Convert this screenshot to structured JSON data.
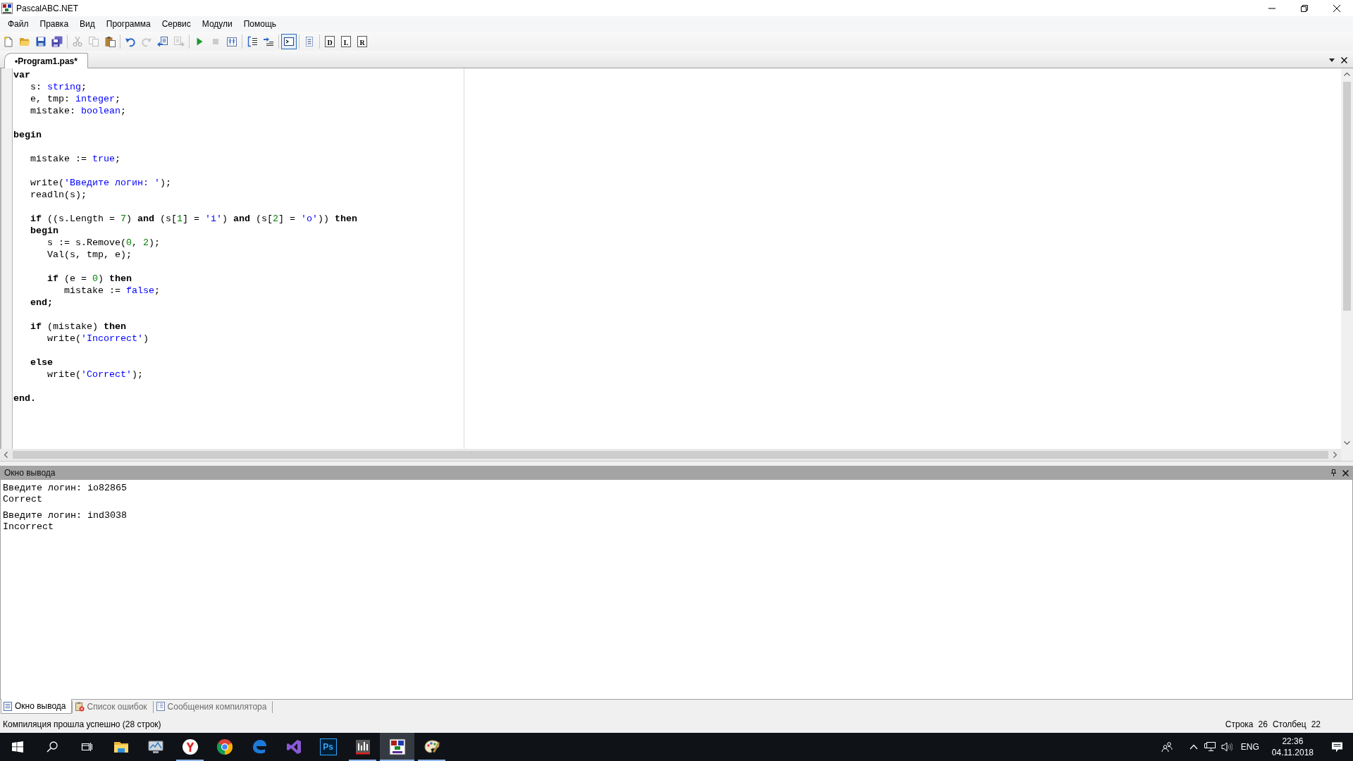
{
  "window": {
    "title": "PascalABC.NET"
  },
  "menu": [
    "Файл",
    "Правка",
    "Вид",
    "Программа",
    "Сервис",
    "Модули",
    "Помощь"
  ],
  "toolbar": [
    {
      "items": [
        {
          "kind": "icon",
          "disabled": false,
          "pressed": false
        },
        {
          "kind": "icon",
          "disabled": false,
          "pressed": false
        },
        {
          "kind": "icon",
          "disabled": false,
          "pressed": false
        },
        {
          "kind": "icon",
          "disabled": false,
          "pressed": false
        }
      ]
    },
    {
      "items": [
        {
          "kind": "icon",
          "disabled": true,
          "pressed": false
        },
        {
          "kind": "icon",
          "disabled": true,
          "pressed": false
        },
        {
          "kind": "icon",
          "disabled": false,
          "pressed": false
        }
      ]
    },
    {
      "items": [
        {
          "kind": "icon",
          "disabled": false,
          "pressed": false
        },
        {
          "kind": "icon",
          "disabled": true,
          "pressed": false
        },
        {
          "kind": "icon",
          "disabled": false,
          "pressed": false
        },
        {
          "kind": "icon",
          "disabled": true,
          "pressed": false
        }
      ]
    },
    {
      "items": [
        {
          "kind": "icon",
          "disabled": false,
          "pressed": false
        },
        {
          "kind": "icon",
          "disabled": true,
          "pressed": false
        },
        {
          "kind": "icon",
          "disabled": false,
          "pressed": false
        }
      ]
    },
    {
      "items": [
        {
          "kind": "icon",
          "disabled": false,
          "pressed": false
        },
        {
          "kind": "icon",
          "disabled": false,
          "pressed": false
        }
      ]
    },
    {
      "items": [
        {
          "kind": "icon",
          "disabled": false,
          "pressed": true
        }
      ]
    },
    {
      "items": [
        {
          "kind": "icon",
          "disabled": false,
          "pressed": false
        }
      ]
    },
    {
      "items": [
        {
          "kind": "letter",
          "label": "D",
          "disabled": false,
          "pressed": false
        },
        {
          "kind": "letter",
          "label": "L",
          "disabled": false,
          "pressed": false
        },
        {
          "kind": "letter",
          "label": "R",
          "disabled": false,
          "pressed": false
        }
      ]
    }
  ],
  "editor": {
    "tabs": [
      {
        "label": "•Program1.pas*",
        "selected": true
      }
    ],
    "lines": [
      {
        "kind": "code",
        "tokens": [
          {
            "kind": "keyword",
            "text": "var"
          }
        ]
      },
      {
        "kind": "code",
        "tokens": [
          {
            "kind": "plain",
            "text": "   s: "
          },
          {
            "kind": "type",
            "text": "string"
          },
          {
            "kind": "plain",
            "text": ";"
          }
        ]
      },
      {
        "kind": "code",
        "tokens": [
          {
            "kind": "plain",
            "text": "   e, tmp: "
          },
          {
            "kind": "type",
            "text": "integer"
          },
          {
            "kind": "plain",
            "text": ";"
          }
        ]
      },
      {
        "kind": "code",
        "tokens": [
          {
            "kind": "plain",
            "text": "   mistake: "
          },
          {
            "kind": "type",
            "text": "boolean"
          },
          {
            "kind": "plain",
            "text": ";"
          }
        ]
      },
      {
        "kind": "blank"
      },
      {
        "kind": "code",
        "tokens": [
          {
            "kind": "keyword",
            "text": "begin"
          }
        ]
      },
      {
        "kind": "blank"
      },
      {
        "kind": "code",
        "tokens": [
          {
            "kind": "plain",
            "text": "   mistake := "
          },
          {
            "kind": "constant",
            "text": "true"
          },
          {
            "kind": "plain",
            "text": ";"
          }
        ]
      },
      {
        "kind": "blank"
      },
      {
        "kind": "code",
        "tokens": [
          {
            "kind": "plain",
            "text": "   write("
          },
          {
            "kind": "string",
            "text": "'Введите логин: '"
          },
          {
            "kind": "plain",
            "text": ");"
          }
        ]
      },
      {
        "kind": "code",
        "tokens": [
          {
            "kind": "plain",
            "text": "   readln(s);"
          }
        ]
      },
      {
        "kind": "blank"
      },
      {
        "kind": "code",
        "tokens": [
          {
            "kind": "keyword",
            "text": "   if"
          },
          {
            "kind": "plain",
            "text": " ((s.Length = "
          },
          {
            "kind": "number",
            "text": "7"
          },
          {
            "kind": "plain",
            "text": ") "
          },
          {
            "kind": "keyword",
            "text": "and"
          },
          {
            "kind": "plain",
            "text": " (s["
          },
          {
            "kind": "number",
            "text": "1"
          },
          {
            "kind": "plain",
            "text": "] = "
          },
          {
            "kind": "string",
            "text": "'i'"
          },
          {
            "kind": "plain",
            "text": ") "
          },
          {
            "kind": "keyword",
            "text": "and"
          },
          {
            "kind": "plain",
            "text": " (s["
          },
          {
            "kind": "number",
            "text": "2"
          },
          {
            "kind": "plain",
            "text": "] = "
          },
          {
            "kind": "string",
            "text": "'o'"
          },
          {
            "kind": "plain",
            "text": ")) "
          },
          {
            "kind": "keyword",
            "text": "then"
          }
        ]
      },
      {
        "kind": "code",
        "tokens": [
          {
            "kind": "keyword",
            "text": "   begin"
          }
        ]
      },
      {
        "kind": "code",
        "tokens": [
          {
            "kind": "plain",
            "text": "      s := s.Remove("
          },
          {
            "kind": "number",
            "text": "0"
          },
          {
            "kind": "plain",
            "text": ", "
          },
          {
            "kind": "number",
            "text": "2"
          },
          {
            "kind": "plain",
            "text": ");"
          }
        ]
      },
      {
        "kind": "code",
        "tokens": [
          {
            "kind": "plain",
            "text": "      Val(s, tmp, e);"
          }
        ]
      },
      {
        "kind": "blank"
      },
      {
        "kind": "code",
        "tokens": [
          {
            "kind": "keyword",
            "text": "      if"
          },
          {
            "kind": "plain",
            "text": " (e = "
          },
          {
            "kind": "number",
            "text": "0"
          },
          {
            "kind": "plain",
            "text": ") "
          },
          {
            "kind": "keyword",
            "text": "then"
          }
        ]
      },
      {
        "kind": "code",
        "tokens": [
          {
            "kind": "plain",
            "text": "         mistake := "
          },
          {
            "kind": "constant",
            "text": "false"
          },
          {
            "kind": "plain",
            "text": ";"
          }
        ]
      },
      {
        "kind": "code",
        "tokens": [
          {
            "kind": "keyword",
            "text": "   end;"
          }
        ]
      },
      {
        "kind": "blank"
      },
      {
        "kind": "code",
        "tokens": [
          {
            "kind": "keyword",
            "text": "   if"
          },
          {
            "kind": "plain",
            "text": " (mistake) "
          },
          {
            "kind": "keyword",
            "text": "then"
          }
        ]
      },
      {
        "kind": "code",
        "tokens": [
          {
            "kind": "plain",
            "text": "      write("
          },
          {
            "kind": "string",
            "text": "'Incorrect'"
          },
          {
            "kind": "plain",
            "text": ")"
          }
        ]
      },
      {
        "kind": "blank"
      },
      {
        "kind": "code",
        "tokens": [
          {
            "kind": "keyword",
            "text": "   else"
          }
        ]
      },
      {
        "kind": "code",
        "tokens": [
          {
            "kind": "plain",
            "text": "      write("
          },
          {
            "kind": "string",
            "text": "'Correct'"
          },
          {
            "kind": "plain",
            "text": ");"
          }
        ]
      },
      {
        "kind": "blank"
      },
      {
        "kind": "code",
        "tokens": [
          {
            "kind": "keyword",
            "text": "end."
          }
        ]
      }
    ]
  },
  "output": {
    "title": "Окно вывода",
    "groups": [
      {
        "lines": [
          "Введите логин: io82865",
          "Correct"
        ]
      },
      {
        "lines": [
          "Введите логин: ind3038",
          "Incorrect"
        ]
      }
    ]
  },
  "panel_tabs": [
    {
      "label": "Окно вывода",
      "selected": true
    },
    {
      "label": "Список ошибок",
      "selected": false
    },
    {
      "label": "Сообщения компилятора",
      "selected": false
    }
  ],
  "status_bar": {
    "message": "Компиляция прошла успешно (28 строк)",
    "line_label": "Строка",
    "line": "26",
    "column_label": "Столбец",
    "column": "22"
  },
  "taskbar": {
    "apps": [
      {
        "open": false,
        "active": false
      },
      {
        "open": false,
        "active": false
      },
      {
        "open": true,
        "active": false
      },
      {
        "open": false,
        "active": false
      },
      {
        "open": false,
        "active": false
      },
      {
        "open": false,
        "active": false
      },
      {
        "label": "Ps",
        "open": false,
        "active": false
      },
      {
        "open": true,
        "active": false
      },
      {
        "open": true,
        "active": true
      },
      {
        "open": true,
        "active": false
      }
    ],
    "language": "ENG",
    "time": "22:36",
    "date": "04.11.2018"
  }
}
